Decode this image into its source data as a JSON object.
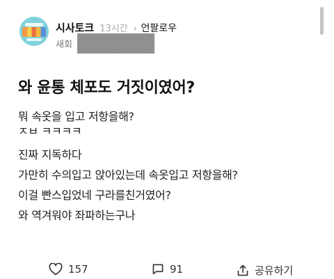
{
  "author": {
    "name": "시사토크",
    "time": "13시간",
    "category": "언팔로우",
    "subtitle_visible": "새회"
  },
  "post": {
    "title": "와 윤통 체포도 거짓이였어?",
    "lines": [
      "뭐 속옷을 입고 저항을해?",
      "ㅈㅂ ㅋㅋㅋㅋ",
      "진짜 지독하다",
      "가만히 수의입고 앉아있는데 속옷입고 저항을해?",
      "이걸 빤스입었네 구라를친거였어?",
      "와 역겨워야 좌파하는구나"
    ]
  },
  "actions": {
    "likes": "157",
    "comments": "91",
    "share_label": "공유하기"
  },
  "icons": {
    "like": "heart-icon",
    "comment": "comment-icon",
    "share": "share-icon",
    "chevron": "chevron-right-icon"
  },
  "colors": {
    "avatar_bg": "#7fd2dc",
    "redaction": "#8e8e8e",
    "muted_text": "#aaaaaa"
  }
}
